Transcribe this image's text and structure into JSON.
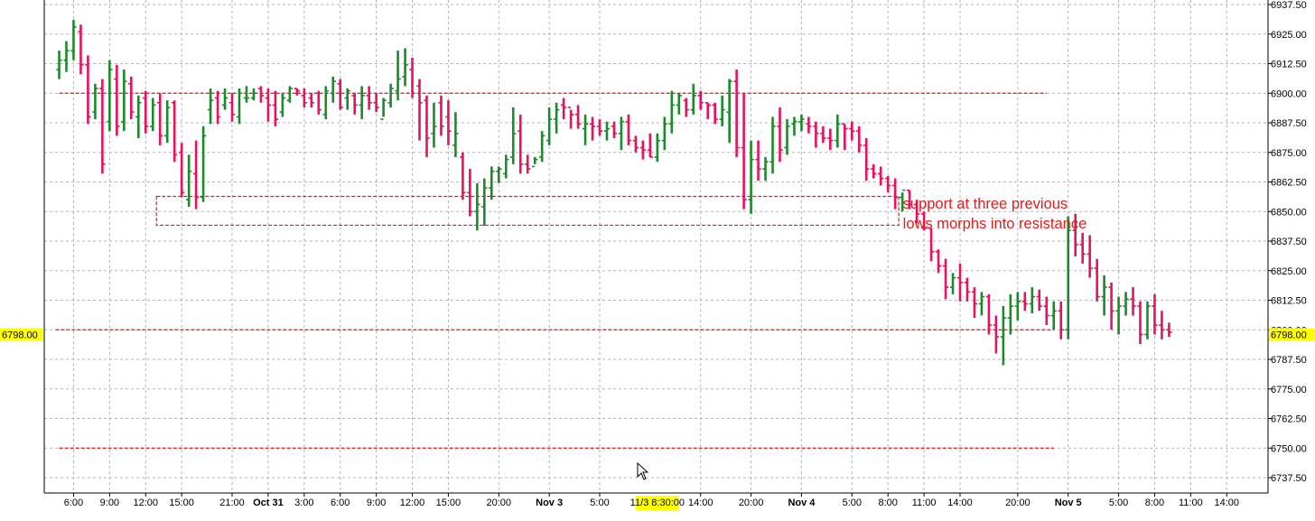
{
  "chart_data": {
    "type": "bar",
    "subtype": "ohlc",
    "grid": true,
    "y_axis": {
      "ylim": [
        6731.0,
        6943.5
      ],
      "ticks": [
        6937.5,
        6925.0,
        6912.5,
        6900.0,
        6887.5,
        6875.0,
        6862.5,
        6850.0,
        6837.5,
        6825.0,
        6812.5,
        6800.0,
        6787.5,
        6775.0,
        6762.5,
        6750.0,
        6737.5
      ],
      "tick_labels": [
        "6937.50",
        "6925.00",
        "6912.50",
        "6900.00",
        "6887.50",
        "6875.00",
        "6862.50",
        "6850.00",
        "6837.50",
        "6825.00",
        "6812.50",
        "6800.00",
        "6787.50",
        "6775.00",
        "6762.50",
        "6750.00",
        "6737.50"
      ],
      "last_price_label": "6798.00",
      "last_price": 6798.0
    },
    "x_axis": {
      "xlim": [
        0,
        168
      ],
      "tick_labels": [
        {
          "x": 2,
          "label": "6:00",
          "bold": false
        },
        {
          "x": 7,
          "label": "9:00",
          "bold": false
        },
        {
          "x": 12,
          "label": "12:00",
          "bold": false
        },
        {
          "x": 17,
          "label": "15:00",
          "bold": false
        },
        {
          "x": 24,
          "label": "21:00",
          "bold": false
        },
        {
          "x": 29,
          "label": "Oct 31",
          "bold": true
        },
        {
          "x": 34,
          "label": "3:00",
          "bold": false
        },
        {
          "x": 39,
          "label": "6:00",
          "bold": false
        },
        {
          "x": 44,
          "label": "9:00",
          "bold": false
        },
        {
          "x": 49,
          "label": "12:00",
          "bold": false
        },
        {
          "x": 54,
          "label": "15:00",
          "bold": false
        },
        {
          "x": 61,
          "label": "20:00",
          "bold": false
        },
        {
          "x": 68,
          "label": "Nov 3",
          "bold": true
        },
        {
          "x": 75,
          "label": "5:00",
          "bold": false
        },
        {
          "x": 89,
          "label": "14:00",
          "bold": false
        },
        {
          "x": 96,
          "label": "20:00",
          "bold": false
        },
        {
          "x": 103,
          "label": "Nov 4",
          "bold": true
        },
        {
          "x": 110,
          "label": "5:00",
          "bold": false
        },
        {
          "x": 115,
          "label": "8:00",
          "bold": false
        },
        {
          "x": 120,
          "label": "11:00",
          "bold": false
        },
        {
          "x": 125,
          "label": "14:00",
          "bold": false
        },
        {
          "x": 133,
          "label": "20:00",
          "bold": false
        },
        {
          "x": 140,
          "label": "Nov 5",
          "bold": true
        },
        {
          "x": 147,
          "label": "5:00",
          "bold": false
        },
        {
          "x": 152,
          "label": "8:00",
          "bold": false
        },
        {
          "x": 157,
          "label": "11:00",
          "bold": false
        },
        {
          "x": 162,
          "label": "14:00",
          "bold": false
        }
      ],
      "highlight_label": {
        "x": 83,
        "label": "11/3 8:30:00"
      }
    },
    "series": [
      {
        "ohlc": [
          [
            6910,
            6918,
            6906,
            6914
          ],
          [
            6914,
            6922,
            6909,
            6918
          ],
          [
            6918,
            6931,
            6914,
            6928
          ],
          [
            6926,
            6929,
            6908,
            6912
          ],
          [
            6912,
            6916,
            6887,
            6890
          ],
          [
            6892,
            6904,
            6889,
            6902
          ],
          [
            6902,
            6906,
            6866,
            6870
          ],
          [
            6888,
            6914,
            6884,
            6910
          ],
          [
            6906,
            6912,
            6882,
            6886
          ],
          [
            6888,
            6910,
            6884,
            6905
          ],
          [
            6904,
            6907,
            6889,
            6892
          ],
          [
            6890,
            6899,
            6881,
            6896
          ],
          [
            6898,
            6901,
            6883,
            6886
          ],
          [
            6886,
            6898,
            6884,
            6895
          ],
          [
            6896,
            6900,
            6878,
            6882
          ],
          [
            6882,
            6897,
            6879,
            6894
          ],
          [
            6896,
            6897,
            6871,
            6874
          ],
          [
            6875,
            6879,
            6856,
            6858
          ],
          [
            6855,
            6874,
            6852,
            6867
          ],
          [
            6866,
            6880,
            6851,
            6856
          ],
          [
            6856,
            6886,
            6854,
            6882
          ],
          [
            6893,
            6902,
            6887,
            6897
          ],
          [
            6898,
            6901,
            6887,
            6890
          ],
          [
            6895,
            6902,
            6893,
            6898
          ],
          [
            6896,
            6900,
            6888,
            6891
          ],
          [
            6890,
            6902,
            6887,
            6900
          ],
          [
            6898,
            6903,
            6896,
            6898
          ],
          [
            6898,
            6902,
            6897,
            6900
          ],
          [
            6902,
            6903,
            6896,
            6899
          ],
          [
            6898,
            6902,
            6888,
            6895
          ],
          [
            6895,
            6901,
            6886,
            6889
          ],
          [
            6892,
            6900,
            6890,
            6898
          ],
          [
            6897,
            6903,
            6896,
            6902
          ],
          [
            6902,
            6902,
            6899,
            6901
          ],
          [
            6899,
            6902,
            6894,
            6896
          ],
          [
            6898,
            6900,
            6894,
            6896
          ],
          [
            6900,
            6901,
            6891,
            6893
          ],
          [
            6891,
            6903,
            6889,
            6901
          ],
          [
            6900,
            6907,
            6896,
            6905
          ],
          [
            6904,
            6906,
            6893,
            6894
          ],
          [
            6898,
            6902,
            6893,
            6901
          ],
          [
            6899,
            6900,
            6891,
            6895
          ],
          [
            6895,
            6903,
            6889,
            6899
          ],
          [
            6899,
            6903,
            6893,
            6896
          ],
          [
            6896,
            6900,
            6892,
            6894
          ],
          [
            6889,
            6898,
            6890,
            6897
          ],
          [
            6896,
            6904,
            6894,
            6902
          ],
          [
            6901,
            6918,
            6897,
            6906
          ],
          [
            6907,
            6919,
            6903,
            6912
          ],
          [
            6910,
            6915,
            6898,
            6900
          ],
          [
            6903,
            6906,
            6880,
            6896
          ],
          [
            6897,
            6899,
            6873,
            6881
          ],
          [
            6883,
            6896,
            6877,
            6886
          ],
          [
            6896,
            6899,
            6882,
            6886
          ],
          [
            6890,
            6897,
            6878,
            6884
          ],
          [
            6878,
            6892,
            6873,
            6883
          ],
          [
            6873,
            6875,
            6855,
            6858
          ],
          [
            6858,
            6868,
            6848,
            6850
          ],
          [
            6850,
            6862,
            6842,
            6853
          ],
          [
            6852,
            6864,
            6844,
            6860
          ],
          [
            6860,
            6869,
            6855,
            6867
          ],
          [
            6867,
            6869,
            6862,
            6868
          ],
          [
            6866,
            6874,
            6864,
            6872
          ],
          [
            6873,
            6894,
            6870,
            6883
          ],
          [
            6884,
            6891,
            6866,
            6870
          ],
          [
            6870,
            6874,
            6866,
            6868
          ],
          [
            6869,
            6873,
            6870,
            6872
          ],
          [
            6873,
            6884,
            6871,
            6882
          ],
          [
            6880,
            6894,
            6878,
            6889
          ],
          [
            6889,
            6896,
            6883,
            6893
          ],
          [
            6895,
            6898,
            6889,
            6894
          ],
          [
            6894,
            6893,
            6885,
            6891
          ],
          [
            6891,
            6895,
            6885,
            6887
          ],
          [
            6885,
            6891,
            6878,
            6887
          ],
          [
            6887,
            6890,
            6880,
            6886
          ],
          [
            6886,
            6889,
            6882,
            6884
          ],
          [
            6884,
            6888,
            6880,
            6885
          ],
          [
            6886,
            6888,
            6881,
            6883
          ],
          [
            6883,
            6890,
            6876,
            6888
          ],
          [
            6888,
            6891,
            6878,
            6880
          ],
          [
            6880,
            6882,
            6875,
            6877
          ],
          [
            6877,
            6880,
            6872,
            6876
          ],
          [
            6876,
            6883,
            6873,
            6873
          ],
          [
            6873,
            6883,
            6871,
            6880
          ],
          [
            6880,
            6890,
            6876,
            6887
          ],
          [
            6887,
            6901,
            6883,
            6895
          ],
          [
            6895,
            6900,
            6891,
            6899
          ],
          [
            6897,
            6898,
            6890,
            6893
          ],
          [
            6893,
            6904,
            6891,
            6899
          ],
          [
            6899,
            6901,
            6893,
            6896
          ],
          [
            6896,
            6896,
            6889,
            6895
          ],
          [
            6895,
            6896,
            6887,
            6889
          ],
          [
            6889,
            6899,
            6886,
            6893
          ],
          [
            6892,
            6906,
            6879,
            6905
          ],
          [
            6905,
            6910,
            6873,
            6877
          ],
          [
            6877,
            6900,
            6851,
            6855
          ],
          [
            6855,
            6880,
            6849,
            6872
          ],
          [
            6872,
            6880,
            6863,
            6868
          ],
          [
            6868,
            6873,
            6863,
            6871
          ],
          [
            6871,
            6890,
            6866,
            6886
          ],
          [
            6886,
            6894,
            6871,
            6876
          ],
          [
            6877,
            6889,
            6874,
            6886
          ],
          [
            6887,
            6890,
            6882,
            6888
          ],
          [
            6888,
            6891,
            6884,
            6889
          ],
          [
            6887,
            6890,
            6883,
            6886
          ],
          [
            6886,
            6888,
            6877,
            6883
          ],
          [
            6883,
            6886,
            6879,
            6881
          ],
          [
            6881,
            6885,
            6876,
            6880
          ],
          [
            6880,
            6891,
            6877,
            6887
          ],
          [
            6887,
            6887,
            6876,
            6885
          ],
          [
            6885,
            6888,
            6880,
            6884
          ],
          [
            6884,
            6886,
            6875,
            6878
          ],
          [
            6878,
            6881,
            6863,
            6868
          ],
          [
            6868,
            6870,
            6864,
            6866
          ],
          [
            6866,
            6869,
            6861,
            6864
          ],
          [
            6864,
            6865,
            6858,
            6861
          ],
          [
            6861,
            6864,
            6851,
            6856
          ],
          [
            6856,
            6858,
            6850,
            6859
          ],
          [
            6859,
            6859,
            6851,
            6853
          ],
          [
            6853,
            6855,
            6845,
            6849
          ],
          [
            6849,
            6850,
            6842,
            6843
          ],
          [
            6843,
            6843,
            6829,
            6833
          ],
          [
            6833,
            6834,
            6824,
            6827
          ],
          [
            6827,
            6830,
            6813,
            6818
          ],
          [
            6818,
            6824,
            6815,
            6822
          ],
          [
            6822,
            6828,
            6812,
            6820
          ],
          [
            6820,
            6822,
            6812,
            6816
          ],
          [
            6816,
            6818,
            6805,
            6811
          ],
          [
            6811,
            6816,
            6806,
            6814
          ],
          [
            6814,
            6815,
            6798,
            6802
          ],
          [
            6802,
            6806,
            6790,
            6797
          ],
          [
            6797,
            6810,
            6785,
            6805
          ],
          [
            6805,
            6815,
            6798,
            6810
          ],
          [
            6810,
            6816,
            6804,
            6812
          ],
          [
            6812,
            6816,
            6808,
            6811
          ],
          [
            6811,
            6818,
            6807,
            6814
          ],
          [
            6814,
            6817,
            6808,
            6810
          ],
          [
            6810,
            6814,
            6802,
            6806
          ],
          [
            6806,
            6812,
            6800,
            6808
          ],
          [
            6808,
            6812,
            6796,
            6800
          ],
          [
            6800,
            6848,
            6796,
            6842
          ],
          [
            6842,
            6849,
            6831,
            6836
          ],
          [
            6836,
            6841,
            6828,
            6832
          ],
          [
            6832,
            6840,
            6822,
            6826
          ],
          [
            6826,
            6830,
            6812,
            6814
          ],
          [
            6814,
            6823,
            6806,
            6818
          ],
          [
            6818,
            6820,
            6800,
            6808
          ],
          [
            6808,
            6814,
            6798,
            6810
          ],
          [
            6810,
            6816,
            6806,
            6813
          ],
          [
            6813,
            6818,
            6806,
            6810
          ],
          [
            6810,
            6812,
            6794,
            6798
          ],
          [
            6798,
            6812,
            6796,
            6810
          ],
          [
            6810,
            6815,
            6798,
            6802
          ],
          [
            6802,
            6808,
            6796,
            6800
          ],
          [
            6800,
            6803,
            6797,
            6799
          ]
        ]
      }
    ],
    "lines": [
      {
        "y": 6900,
        "x_start": 0,
        "x_end": 137
      },
      {
        "y": 6800,
        "x_start": -0.5,
        "x_end": 138
      },
      {
        "y": 6750,
        "x_start": 0,
        "x_end": 138
      }
    ],
    "zone": {
      "y_top": 6856.4,
      "y_bottom": 6844.2,
      "x_start": 13.5,
      "x_end": 116.5
    },
    "annotation": {
      "lines": [
        "support at three previous",
        "lows morphs into resistance"
      ],
      "x": 117,
      "y": 6855
    }
  },
  "colors": {
    "up": "#1b8a2b",
    "down": "#e8115b",
    "grid": "#b3b3b3",
    "reference_line": "#e21b1b",
    "annotation_text": "#e21b1b",
    "highlight": "#ffff00",
    "axis_text": "#000000"
  },
  "icons": {
    "cursor": "mouse-pointer-icon"
  }
}
